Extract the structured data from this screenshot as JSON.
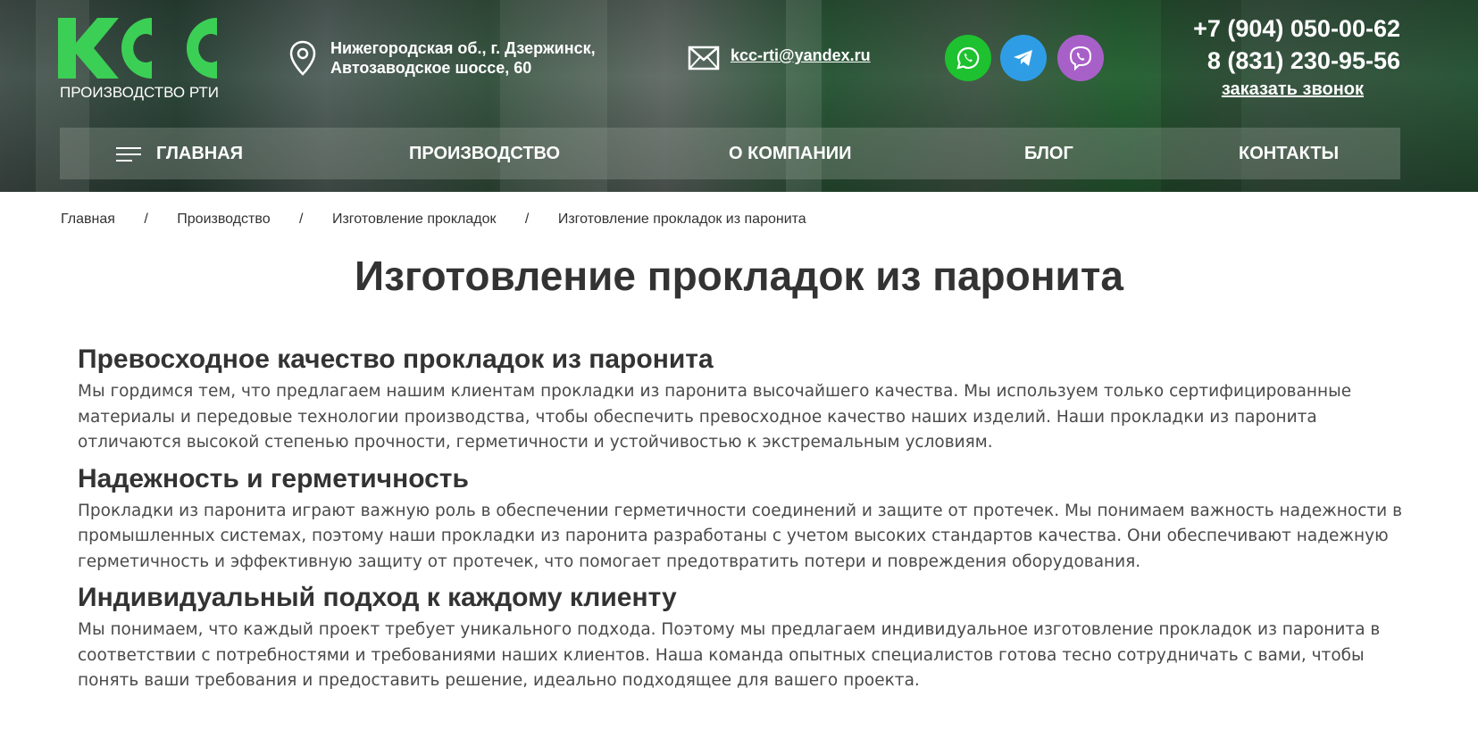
{
  "header": {
    "logo_sub": "ПРОИЗВОДСТВО РТИ",
    "address_line1": "Нижегородская об., г. Дзержинск,",
    "address_line2": "Автозаводское шоссе, 60",
    "email": "kcc-rti@yandex.ru",
    "phone1": "+7 (904) 050-00-62",
    "phone2": "8 (831) 230-95-56",
    "callback": "заказать звонок",
    "social": [
      "whatsapp-icon",
      "telegram-icon",
      "viber-icon"
    ],
    "colors": {
      "logo_green": "#3ccf55",
      "whatsapp": "#1ec12f",
      "telegram": "#2f9de6",
      "viber": "#a860c9"
    }
  },
  "nav": {
    "items": [
      "ГЛАВНАЯ",
      "ПРОИЗВОДСТВО",
      "О КОМПАНИИ",
      "БЛОГ",
      "КОНТАКТЫ"
    ]
  },
  "breadcrumb": {
    "items": [
      "Главная",
      "Производство",
      "Изготовление прокладок",
      "Изготовление прокладок из паронита"
    ],
    "separator": "/"
  },
  "page": {
    "title": "Изготовление прокладок из паронита",
    "sections": [
      {
        "heading": "Превосходное качество прокладок из паронита",
        "text": "Мы гордимся тем, что предлагаем нашим клиентам прокладки из паронита высочайшего качества. Мы используем только сертифицированные материалы и передовые технологии производства, чтобы обеспечить превосходное качество наших изделий. Наши прокладки из паронита отличаются высокой степенью прочности, герметичности и устойчивостью к экстремальным условиям."
      },
      {
        "heading": "Надежность и герметичность",
        "text": "Прокладки из паронита играют важную роль в обеспечении герметичности соединений и защите от протечек. Мы понимаем важность надежности в промышленных системах, поэтому наши прокладки из паронита разработаны с учетом высоких стандартов качества. Они обеспечивают надежную герметичность и эффективную защиту от протечек, что помогает предотвратить потери и повреждения оборудования."
      },
      {
        "heading": "Индивидуальный подход к каждому клиенту",
        "text": "Мы понимаем, что каждый проект требует уникального подхода. Поэтому мы предлагаем индивидуальное изготовление прокладок из паронита в соответствии с потребностями и требованиями наших клиентов. Наша команда опытных специалистов готова тесно сотрудничать с вами, чтобы понять ваши требования и предоставить решение, идеально подходящее для вашего проекта."
      }
    ]
  }
}
